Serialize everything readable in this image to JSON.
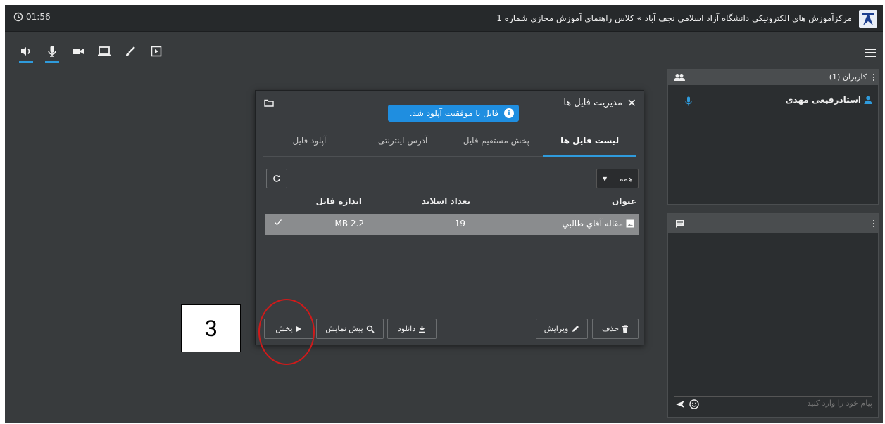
{
  "header": {
    "timer": "01:56",
    "title": "مرکزآموزش های الکترونیکی دانشگاه آزاد اسلامی نجف آباد » کلاس راهنمای آموزش مجازی شماره 1"
  },
  "toolbar": {
    "icons": [
      "speaker-icon",
      "microphone-icon",
      "camera-icon",
      "screen-share-icon",
      "whiteboard-pen-icon",
      "presentation-icon"
    ]
  },
  "users_panel": {
    "title": "کاربران (1)",
    "user_name": "استادرفیعی مهدی"
  },
  "chat_panel": {
    "placeholder": "پیام خود را وارد کنید"
  },
  "dialog": {
    "title": "مدیریت فایل ها",
    "toast": "فایل با موفقیت آپلود شد.",
    "tabs": [
      "لیست فایل ها",
      "پخش مستقیم فایل",
      "آدرس اینترنتی",
      "آپلود فایل"
    ],
    "filter": "همه",
    "columns": {
      "title": "عنوان",
      "slides": "تعداد اسلاید",
      "size": "اندازه فایل"
    },
    "rows": [
      {
        "name": "مقاله آقاي طالبي",
        "slides": "19",
        "size": "2.2 MB"
      }
    ],
    "buttons": {
      "delete": "حذف",
      "edit": "ویرایش",
      "download": "دانلود",
      "preview": "پیش نمایش",
      "play": "پخش"
    }
  },
  "annotation": {
    "step": "3"
  },
  "colors": {
    "background": "#383b3d",
    "titlebar": "#26292b",
    "accent": "#2f9bdc",
    "toast": "#1f8ee0",
    "highlight_circle": "#d01a1a"
  }
}
